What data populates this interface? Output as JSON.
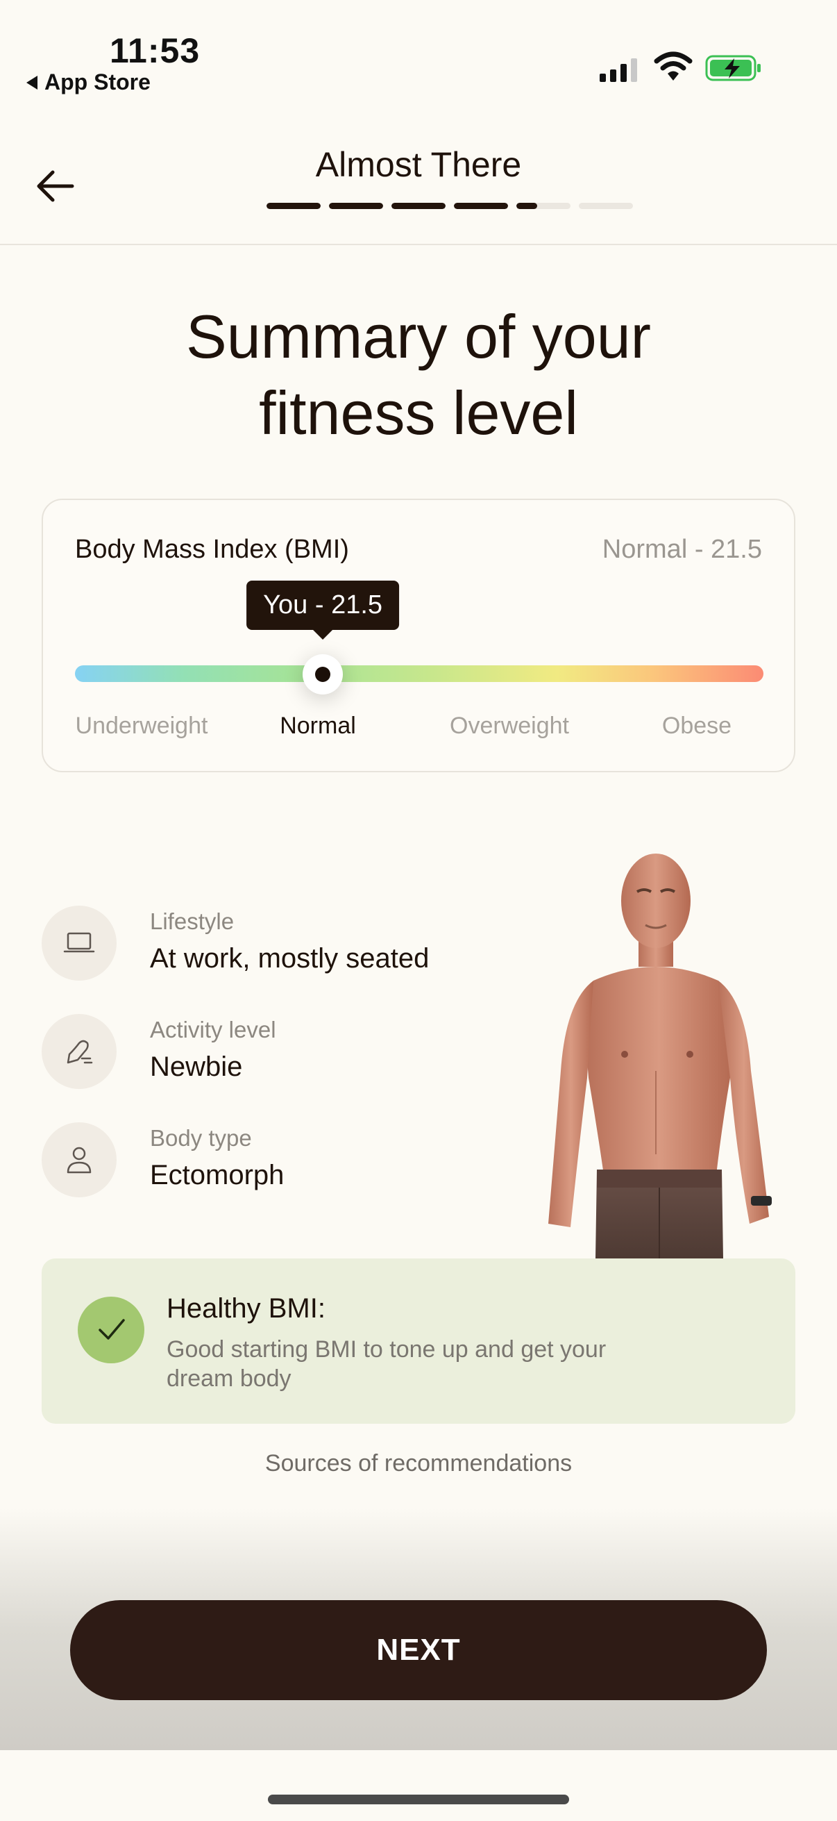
{
  "status_bar": {
    "time": "11:53",
    "back_app": "App Store"
  },
  "header": {
    "title": "Almost There",
    "progress_segments": [
      1,
      1,
      1,
      1,
      0.38,
      0
    ]
  },
  "main": {
    "title_line1": "Summary of your",
    "title_line2": "fitness level"
  },
  "bmi": {
    "label": "Body Mass Index (BMI)",
    "status": "Normal - 21.5",
    "tooltip": "You - 21.5",
    "marker_position": 0.36,
    "categories": [
      {
        "label": "Underweight",
        "active": false
      },
      {
        "label": "Normal",
        "active": true
      },
      {
        "label": "Overweight",
        "active": false
      },
      {
        "label": "Obese",
        "active": false
      }
    ]
  },
  "profile": [
    {
      "label": "Lifestyle",
      "value": "At work, mostly seated",
      "icon": "laptop-icon"
    },
    {
      "label": "Activity level",
      "value": "Newbie",
      "icon": "activity-icon"
    },
    {
      "label": "Body type",
      "value": "Ectomorph",
      "icon": "person-icon"
    }
  ],
  "healthy": {
    "title": "Healthy BMI:",
    "text": "Good starting BMI to tone up and get your dream body"
  },
  "sources_link": "Sources of recommendations",
  "next_button": "NEXT",
  "colors": {
    "accent": "#2e1b15",
    "healthy_bg": "#ebefdc",
    "check": "#a3c870"
  }
}
